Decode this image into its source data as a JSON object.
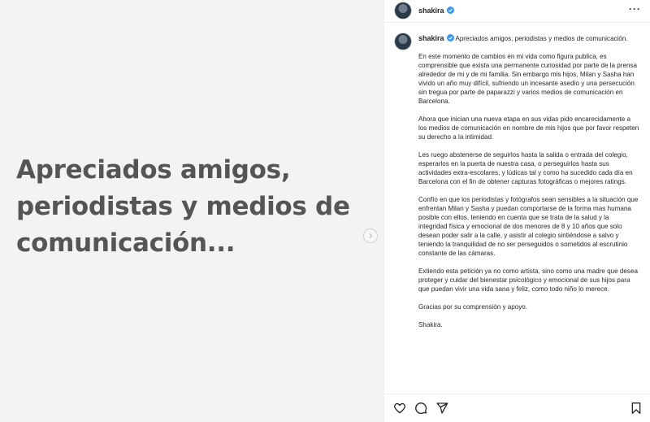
{
  "image": {
    "caption": "Apreciados amigos, periodistas y  medios de comunicación..."
  },
  "post": {
    "username": "shakira",
    "more_label": "···",
    "headline": "Apreciados amigos, periodistas y medios de comunicación.",
    "paragraphs": [
      "En este momento de cambios en mi vida como figura publica, es comprensible que exista una permanente curiosidad por parte de la prensa alrededor de mi y de mi familia. Sin embargo mis hijos, Milan y Sasha han vivido un año muy difícil, sufriendo un incesante asedio y una persecución sin tregua por parte de paparazzi y varios medios de comunicación en Barcelona.",
      "Ahora que inician una nueva etapa en sus vidas pido encarecidamente a los medios de comunicación en nombre de mis hijos que por favor respeten su derecho a la intimidad.",
      "Les ruego abstenerse de seguirlos hasta la salida o entrada del colegio, esperarlos en la puerta de nuestra casa, o perseguirlos hasta sus actividades extra-escolares, y lúdicas tal y como ha sucedido cada día en Barcelona con el fin de obtener capturas fotográficas o mejores ratings.",
      "Confío en que los periodistas y fotógrafos sean sensibles a la situación que enfrentan Milan y Sasha y puedan comportarse de la forma mas humana posible con ellos, teniendo en cuenta que se trata de la salud y la integridad física y emocional de dos menores de 8 y 10 años que solo desean poder salir a la calle, y asistir al colegio sintiéndose a salvo y teniendo la tranquilidad de no ser perseguidos o sometidos al escrutinio constante de las cámaras.",
      "Extiendo esta petición ya no como artista, sino como una madre que desea proteger y cuidar del bienestar psicológico y emocional de sus hijos para que puedan vivir una vida sana y feliz, como todo niño lo merece.",
      "Gracias por su comprensión y apoyo.",
      "Shakira."
    ]
  },
  "colors": {
    "verified": "#3897f0",
    "caption_text": "#555555"
  }
}
